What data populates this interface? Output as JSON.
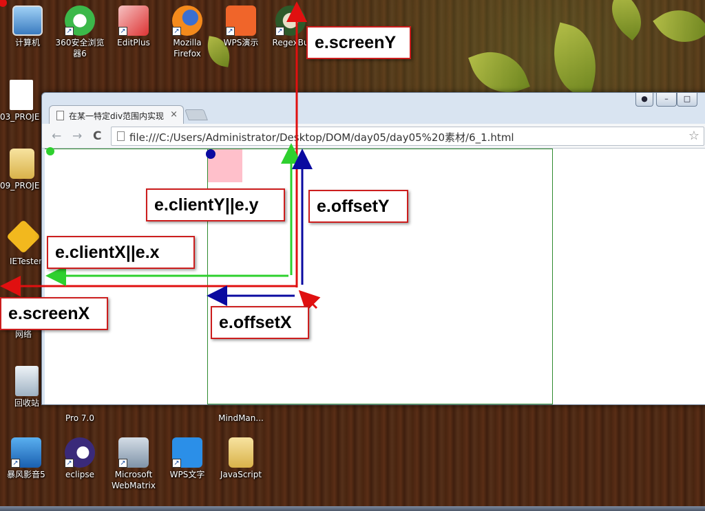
{
  "desktop_icons": [
    {
      "label": "计算机",
      "icon": "computer-icon"
    },
    {
      "label": "360安全浏览器6",
      "icon": "browser-360-icon"
    },
    {
      "label": "EditPlus",
      "icon": "editplus-icon"
    },
    {
      "label": "Mozilla Firefox",
      "icon": "firefox-icon"
    },
    {
      "label": "WPS演示",
      "icon": "wps-presentation-icon"
    },
    {
      "label": "RegexBu",
      "icon": "regexbuddy-icon"
    },
    {
      "label": "03_PROJE",
      "icon": "file-icon"
    },
    {
      "label": "09_PROJE",
      "icon": "folder-icon"
    },
    {
      "label": "IETester",
      "icon": "ietester-icon"
    },
    {
      "label": "网络",
      "icon": "network-icon"
    },
    {
      "label": "回收站",
      "icon": "recycle-bin-icon"
    },
    {
      "label": "Pro 7.0",
      "icon": "axure-icon"
    },
    {
      "label": "MindMan...",
      "icon": "mindmanager-icon"
    },
    {
      "label": "暴风影音5",
      "icon": "baofeng-icon"
    },
    {
      "label": "eclipse",
      "icon": "eclipse-icon"
    },
    {
      "label": "Microsoft WebMatrix",
      "icon": "webmatrix-icon"
    },
    {
      "label": "WPS文字",
      "icon": "wps-writer-icon"
    },
    {
      "label": "JavaScript",
      "icon": "folder-icon"
    }
  ],
  "browser": {
    "tab_title": "在某一特定div范围内实现",
    "tab_close": "×",
    "url": "file:///C:/Users/Administrator/Desktop/DOM/day05/day05%20素材/6_1.html",
    "back": "←",
    "forward": "→",
    "reload": "C",
    "bookmark_star": "☆",
    "window_controls": {
      "user": "●",
      "minimize": "–",
      "maximize": "□"
    }
  },
  "annotations": {
    "screenY": "e.screenY",
    "clientY": "e.clientY||e.y",
    "offsetY": "e.offsetY",
    "clientX": "e.clientX||e.x",
    "screenX": "e.screenX",
    "offsetX": "e.offsetX"
  },
  "colors": {
    "screen_arrows": "#e01010",
    "client_arrows": "#2ed02e",
    "offset_arrows": "#0a0aa0",
    "label_border": "#cc1d1d",
    "div_border": "#2e8a2e",
    "pink_box": "#ffc0cb"
  }
}
